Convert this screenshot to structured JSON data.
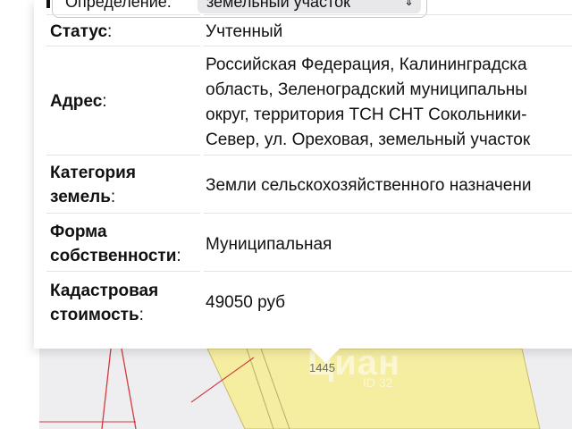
{
  "select": {
    "label": "Определение:",
    "value": "земельный участок",
    "chevron_icon": "chevron-updown-icon"
  },
  "rows": [
    {
      "label": "Статус",
      "value_lines": [
        "Учтенный"
      ]
    },
    {
      "label": "Адрес",
      "value_lines": [
        "Российская Федерация, Калининградска",
        "область, Зеленоградский муниципальны",
        "округ, территория ТСН СНТ Сокольники-",
        "Север, ул. Ореховая, земельный участок"
      ]
    },
    {
      "label_lines": [
        "Категория",
        "земель"
      ],
      "value_lines": [
        "Земли сельскохозяйственного назначени"
      ]
    },
    {
      "label_lines": [
        "Форма",
        "собственности"
      ],
      "value_lines": [
        "Муниципальная"
      ]
    },
    {
      "label_lines": [
        "Кадастровая",
        "стоимость"
      ],
      "value_lines": [
        "49050 руб"
      ]
    }
  ],
  "colon": ":",
  "map": {
    "plot_number": "1445",
    "watermark": "Циан",
    "watermark_sub": "ID 32",
    "plot_fill": "#f5eda0",
    "boundary_color": "#d23b3b",
    "background": "#eeeef0"
  }
}
